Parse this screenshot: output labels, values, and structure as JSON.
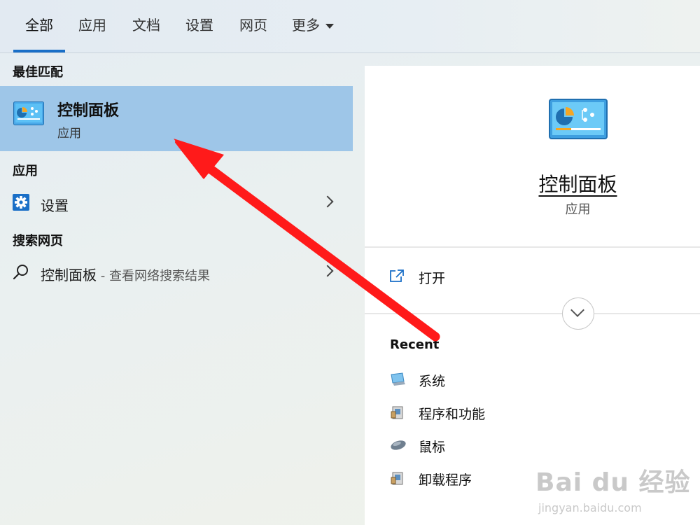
{
  "tabs": [
    {
      "label": "全部",
      "active": true
    },
    {
      "label": "应用",
      "active": false
    },
    {
      "label": "文档",
      "active": false
    },
    {
      "label": "设置",
      "active": false
    },
    {
      "label": "网页",
      "active": false
    },
    {
      "label": "更多",
      "active": false,
      "dropdown": true
    }
  ],
  "left": {
    "best_match_heading": "最佳匹配",
    "best_match": {
      "title": "控制面板",
      "subtitle": "应用",
      "icon": "control-panel-icon",
      "selected": true
    },
    "apps_heading": "应用",
    "apps": [
      {
        "label": "设置",
        "icon": "gear-icon"
      }
    ],
    "web_heading": "搜索网页",
    "web": [
      {
        "label": "控制面板",
        "hint": " - 查看网络搜索结果",
        "icon": "search-icon"
      }
    ]
  },
  "detail": {
    "title": "控制面板",
    "subtitle": "应用",
    "icon": "control-panel-icon",
    "open_label": "打开",
    "recent_heading": "Recent",
    "recent": [
      {
        "label": "系统",
        "icon": "system-icon"
      },
      {
        "label": "程序和功能",
        "icon": "programs-icon"
      },
      {
        "label": "鼠标",
        "icon": "mouse-icon"
      },
      {
        "label": "卸载程序",
        "icon": "programs-icon"
      }
    ]
  },
  "watermark": {
    "brand": "Bai du 经验",
    "url": "jingyan.baidu.com"
  },
  "colors": {
    "accent": "#1a6fc7",
    "selected_bg": "#9ec6e8",
    "arrow": "#ff1a1a"
  }
}
